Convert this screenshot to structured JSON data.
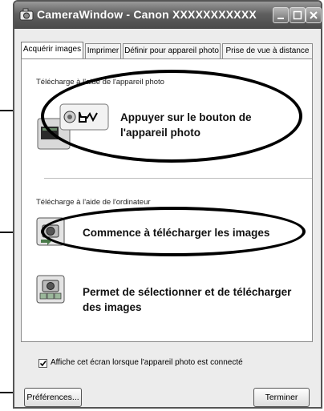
{
  "window": {
    "title": "CameraWindow - Canon XXXXXXXXXXX"
  },
  "tabs": [
    {
      "label": "Acquérir images",
      "active": true
    },
    {
      "label": "Imprimer",
      "active": false
    },
    {
      "label": "Définir pour appareil photo",
      "active": false
    },
    {
      "label": "Prise de vue à distance",
      "active": false
    }
  ],
  "sections": {
    "camera": {
      "heading": "Télécharge à l'aide de l'appareil photo",
      "option_line1": "Appuyer sur le bouton de",
      "option_line2": "l'appareil photo",
      "icon": "camera-button-icon"
    },
    "computer": {
      "heading": "Télécharge à l'aide de l'ordinateur",
      "option1": "Commence à télécharger les images",
      "option1_icon": "start-download-icon",
      "option2_line1": "Permet de sélectionner et de télécharger",
      "option2_line2": "des images",
      "option2_icon": "select-download-icon"
    }
  },
  "checkbox": {
    "label": "Affiche cet écran lorsque l'appareil photo est connecté",
    "checked": true
  },
  "buttons": {
    "preferences": "Préférences...",
    "finish": "Terminer"
  }
}
